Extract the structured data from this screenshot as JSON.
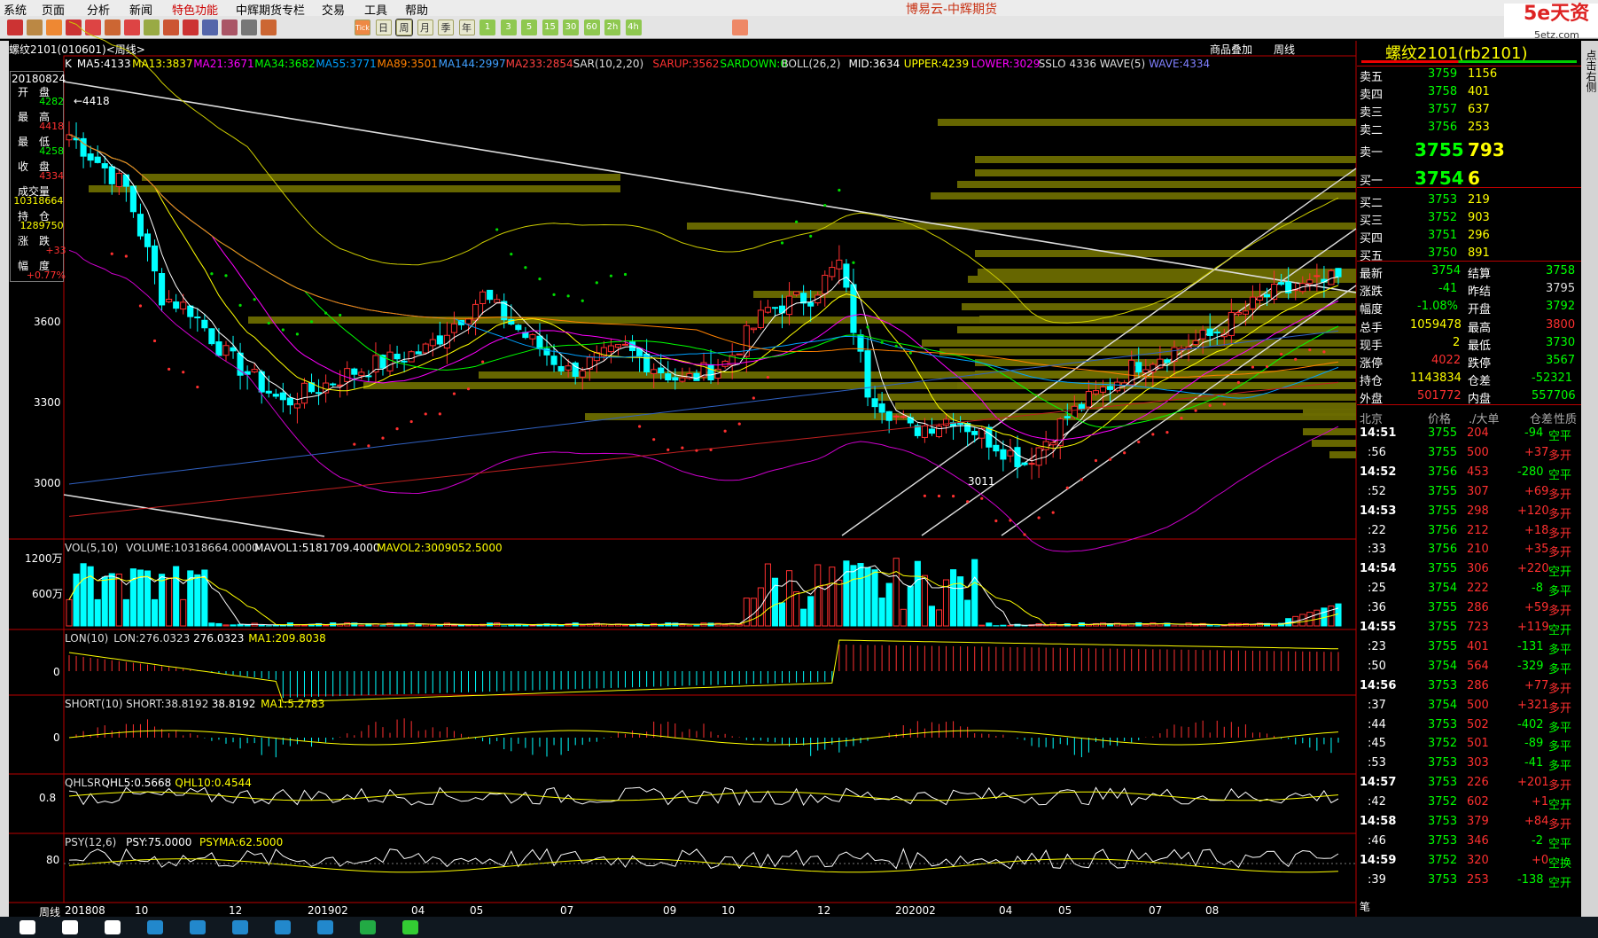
{
  "menu": [
    "系统",
    "页面",
    "分析",
    "新闻",
    "特色功能",
    "中辉期货专栏",
    "交易",
    "工具",
    "帮助"
  ],
  "app_title": "博易云-中辉期货",
  "logo": {
    "brand": "5e天资",
    "site": "5etz.com"
  },
  "toolbar_periods": [
    "Tick",
    "日",
    "周",
    "月",
    "季",
    "年",
    "1",
    "3",
    "5",
    "15",
    "30",
    "60",
    "2h",
    "4h"
  ],
  "chart_header": {
    "left": "螺纹2101(010601)<周线>",
    "overlay": "商品叠加",
    "period": "周线"
  },
  "ma_line": [
    {
      "t": "K",
      "c": "#ffffff"
    },
    {
      "t": "MA5:4133",
      "c": "#ffffff"
    },
    {
      "t": "MA13:3837",
      "c": "#ffff00"
    },
    {
      "t": "MA21:3671",
      "c": "#ff00ff"
    },
    {
      "t": "MA34:3682",
      "c": "#00ff00"
    },
    {
      "t": "MA55:3771",
      "c": "#00a0ff"
    },
    {
      "t": "MA89:3501",
      "c": "#ff8000"
    },
    {
      "t": "MA144:2997",
      "c": "#40a0ff"
    },
    {
      "t": "MA233:2854",
      "c": "#ff4040"
    },
    {
      "t": "SAR(10,2,20)",
      "c": "#dddddd"
    },
    {
      "t": "SARUP:3562",
      "c": "#ff3030"
    },
    {
      "t": "SARDOWN:0",
      "c": "#00ff00"
    },
    {
      "t": "BOLL(26,2)",
      "c": "#dddddd"
    },
    {
      "t": "MID:3634",
      "c": "#ffffff"
    },
    {
      "t": "UPPER:4239",
      "c": "#ffff00"
    },
    {
      "t": "LOWER:3029",
      "c": "#ff00ff"
    },
    {
      "t": "SSLO 4336",
      "c": "#dddddd"
    },
    {
      "t": "WAVE(5)",
      "c": "#dddddd"
    },
    {
      "t": "WAVE:4334",
      "c": "#8080ff"
    }
  ],
  "info_box": {
    "date": "20180824",
    "rows": [
      {
        "label": "开　盘",
        "value": "4282",
        "c": "#00ff00"
      },
      {
        "label": "最　高",
        "value": "4418",
        "c": "#ff3030"
      },
      {
        "label": "最　低",
        "value": "4258",
        "c": "#00ff00"
      },
      {
        "label": "收　盘",
        "value": "4334",
        "c": "#ff3030"
      },
      {
        "label": "成交量",
        "value": "10318664",
        "c": "#ffff00"
      },
      {
        "label": "持　仓",
        "value": "1289750",
        "c": "#ffff00"
      },
      {
        "label": "涨　跌",
        "value": "+33",
        "c": "#ff3030"
      },
      {
        "label": "幅　度",
        "value": "+0.77%",
        "c": "#ff3030"
      }
    ]
  },
  "price_labels": [
    "3600",
    "3300",
    "3000"
  ],
  "chart_marks": {
    "hi": "←4418",
    "lo": "3011"
  },
  "x_labels": [
    "201808",
    "10",
    "12",
    "201902",
    "04",
    "05",
    "07",
    "09",
    "10",
    "12",
    "202002",
    "04",
    "05",
    "07",
    "08"
  ],
  "x_start_label": "周线",
  "panels": [
    {
      "title": [
        {
          "t": "VOL(5,10)",
          "c": "#dddddd"
        },
        {
          "t": "VOLUME:10318664.0000",
          "c": "#dddddd"
        },
        {
          "t": "MAVOL1:5181709.4000",
          "c": "#ffffff"
        },
        {
          "t": "MAVOL2:3009052.5000",
          "c": "#ffff00"
        }
      ],
      "labels": [
        "1200万",
        "600万"
      ]
    },
    {
      "title": [
        {
          "t": "LON(10)",
          "c": "#dddddd"
        },
        {
          "t": "LON:276.0323",
          "c": "#dddddd"
        },
        {
          "t": "276.0323",
          "c": "#ffffff"
        },
        {
          "t": "MA1:209.8038",
          "c": "#ffff00"
        }
      ],
      "labels": [
        "0"
      ]
    },
    {
      "title": [
        {
          "t": "SHORT(10)",
          "c": "#dddddd"
        },
        {
          "t": "SHORT:38.8192",
          "c": "#dddddd"
        },
        {
          "t": "38.8192",
          "c": "#ffffff"
        },
        {
          "t": "MA1:5.2783",
          "c": "#ffff00"
        }
      ],
      "labels": [
        "0"
      ]
    },
    {
      "title": [
        {
          "t": "QHLSR",
          "c": "#dddddd"
        },
        {
          "t": "QHL5:0.5668",
          "c": "#ffffff"
        },
        {
          "t": "QHL10:0.4544",
          "c": "#ffff00"
        }
      ],
      "labels": [
        "0.8"
      ]
    },
    {
      "title": [
        {
          "t": "PSY(12,6)",
          "c": "#dddddd"
        },
        {
          "t": "PSY:75.0000",
          "c": "#ffffff"
        },
        {
          "t": "PSYMA:62.5000",
          "c": "#ffff00"
        }
      ],
      "labels": [
        "80"
      ]
    }
  ],
  "quote": {
    "title": "螺纹2101(rb2101)",
    "sells": [
      {
        "l": "卖五",
        "p": "3759",
        "v": "1156"
      },
      {
        "l": "卖四",
        "p": "3758",
        "v": "401"
      },
      {
        "l": "卖三",
        "p": "3757",
        "v": "637"
      },
      {
        "l": "卖二",
        "p": "3756",
        "v": "253"
      }
    ],
    "sell1": {
      "l": "卖一",
      "p": "3755",
      "v": "793"
    },
    "buy1": {
      "l": "买一",
      "p": "3754",
      "v": "6"
    },
    "buys": [
      {
        "l": "买二",
        "p": "3753",
        "v": "219"
      },
      {
        "l": "买三",
        "p": "3752",
        "v": "903"
      },
      {
        "l": "买四",
        "p": "3751",
        "v": "296"
      },
      {
        "l": "买五",
        "p": "3750",
        "v": "891"
      }
    ],
    "stats": [
      {
        "l1": "最新",
        "v1": "3754",
        "c1": "#00ff00",
        "l2": "结算",
        "v2": "3758",
        "c2": "#00ff00"
      },
      {
        "l1": "涨跌",
        "v1": "-41",
        "c1": "#00ff00",
        "l2": "昨结",
        "v2": "3795",
        "c2": "#dddddd"
      },
      {
        "l1": "幅度",
        "v1": "-1.08%",
        "c1": "#00ff00",
        "l2": "开盘",
        "v2": "3792",
        "c2": "#00ff00"
      },
      {
        "l1": "总手",
        "v1": "1059478",
        "c1": "#ffff00",
        "l2": "最高",
        "v2": "3800",
        "c2": "#ff3030"
      },
      {
        "l1": "现手",
        "v1": "2",
        "c1": "#ffff00",
        "l2": "最低",
        "v2": "3730",
        "c2": "#00ff00"
      },
      {
        "l1": "涨停",
        "v1": "4022",
        "c1": "#ff3030",
        "l2": "跌停",
        "v2": "3567",
        "c2": "#00ff00"
      },
      {
        "l1": "持仓",
        "v1": "1143834",
        "c1": "#ffff00",
        "l2": "仓差",
        "v2": "-52321",
        "c2": "#00ff00"
      },
      {
        "l1": "外盘",
        "v1": "501772",
        "c1": "#ff3030",
        "l2": "内盘",
        "v2": "557706",
        "c2": "#00ff00"
      }
    ],
    "tick_header": [
      "北京",
      "价格",
      "./大单",
      "仓差",
      "性质"
    ],
    "ticks": [
      {
        "t": "14:51",
        "p": "3755",
        "v": "204",
        "d": "-94",
        "n": "空平",
        "nc": "#00ff00"
      },
      {
        "t": ":56",
        "p": "3755",
        "v": "500",
        "d": "+37",
        "n": "多开",
        "nc": "#ff3030"
      },
      {
        "t": "14:52",
        "p": "3756",
        "v": "453",
        "d": "-280",
        "n": "空平",
        "nc": "#00ff00"
      },
      {
        "t": ":52",
        "p": "3755",
        "v": "307",
        "d": "+69",
        "n": "多开",
        "nc": "#ff3030"
      },
      {
        "t": "14:53",
        "p": "3755",
        "v": "298",
        "d": "+120",
        "n": "多开",
        "nc": "#ff3030"
      },
      {
        "t": ":22",
        "p": "3756",
        "v": "212",
        "d": "+18",
        "n": "多开",
        "nc": "#ff3030"
      },
      {
        "t": ":33",
        "p": "3756",
        "v": "210",
        "d": "+35",
        "n": "多开",
        "nc": "#ff3030"
      },
      {
        "t": "14:54",
        "p": "3755",
        "v": "306",
        "d": "+220",
        "n": "空开",
        "nc": "#00ff00"
      },
      {
        "t": ":25",
        "p": "3754",
        "v": "222",
        "d": "-8",
        "n": "多平",
        "nc": "#00ff00"
      },
      {
        "t": ":36",
        "p": "3755",
        "v": "286",
        "d": "+59",
        "n": "多开",
        "nc": "#ff3030"
      },
      {
        "t": "14:55",
        "p": "3755",
        "v": "723",
        "d": "+119",
        "n": "空开",
        "nc": "#00ff00"
      },
      {
        "t": ":23",
        "p": "3755",
        "v": "401",
        "d": "-131",
        "n": "多平",
        "nc": "#00ff00"
      },
      {
        "t": ":50",
        "p": "3754",
        "v": "564",
        "d": "-329",
        "n": "多平",
        "nc": "#00ff00"
      },
      {
        "t": "14:56",
        "p": "3753",
        "v": "286",
        "d": "+77",
        "n": "多开",
        "nc": "#ff3030"
      },
      {
        "t": ":37",
        "p": "3754",
        "v": "500",
        "d": "+321",
        "n": "多开",
        "nc": "#ff3030"
      },
      {
        "t": ":44",
        "p": "3753",
        "v": "502",
        "d": "-402",
        "n": "多平",
        "nc": "#00ff00"
      },
      {
        "t": ":45",
        "p": "3752",
        "v": "501",
        "d": "-89",
        "n": "多平",
        "nc": "#00ff00"
      },
      {
        "t": ":53",
        "p": "3753",
        "v": "303",
        "d": "-41",
        "n": "多平",
        "nc": "#00ff00"
      },
      {
        "t": "14:57",
        "p": "3753",
        "v": "226",
        "d": "+201",
        "n": "多开",
        "nc": "#ff3030"
      },
      {
        "t": ":42",
        "p": "3752",
        "v": "602",
        "d": "+1",
        "n": "空开",
        "nc": "#00ff00"
      },
      {
        "t": "14:58",
        "p": "3753",
        "v": "379",
        "d": "+84",
        "n": "多开",
        "nc": "#ff3030"
      },
      {
        "t": ":46",
        "p": "3753",
        "v": "346",
        "d": "-2",
        "n": "空平",
        "nc": "#00ff00"
      },
      {
        "t": "14:59",
        "p": "3752",
        "v": "320",
        "d": "+0",
        "n": "空换",
        "nc": "#00ff00"
      },
      {
        "t": ":39",
        "p": "3753",
        "v": "253",
        "d": "-138",
        "n": "空开",
        "nc": "#00ff00"
      }
    ],
    "foot": "笔"
  },
  "right_tab": "点击右侧"
}
